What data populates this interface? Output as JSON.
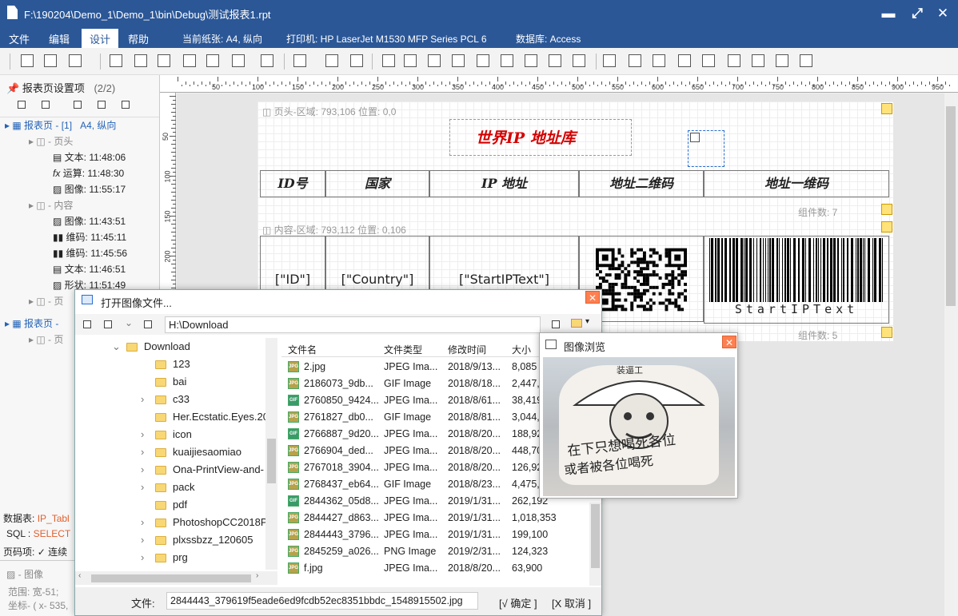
{
  "window": {
    "title": "F:\\190204\\Demo_1\\Demo_1\\bin\\Debug\\测试报表1.rpt"
  },
  "menu": {
    "items": [
      "文件",
      "编辑",
      "设计",
      "帮助"
    ],
    "paper": "当前纸张: A4, 纵向",
    "printer": "打印机: HP LaserJet M1530 MFP Series PCL 6",
    "database": "数据库: Access"
  },
  "left_panel": {
    "header": "报表页设置项",
    "count": "(2/2)",
    "tree": [
      {
        "label": "报表页 - [1]",
        "extra": "A4, 纵向"
      },
      {
        "label": "- 页头"
      },
      {
        "label": "文本: 11:48:06"
      },
      {
        "label": "运算: 11:48:30"
      },
      {
        "label": "图像: 11:55:17"
      },
      {
        "label": "- 内容"
      },
      {
        "label": "图像: 11:43:51"
      },
      {
        "label": "维码: 11:45:11"
      },
      {
        "label": "维码: 11:45:56"
      },
      {
        "label": "文本: 11:46:51"
      },
      {
        "label": "形状: 11:51:49"
      },
      {
        "label": "- 页"
      },
      {
        "label": "报表页 - "
      },
      {
        "label": "- 页"
      }
    ],
    "db_label": "数据表:",
    "db_value": "IP_Tabl",
    "sql_label": "SQL :",
    "sql_value": "SELECT",
    "page_label": "页码项:",
    "page_value": "✓ 连续",
    "status_title": "- 图像",
    "range": "范围: 宽-51;",
    "coords": "坐标- ( x- 535,"
  },
  "ruler": {
    "labels": [
      "50",
      "100",
      "150",
      "200",
      "250",
      "300",
      "350",
      "400",
      "450",
      "500",
      "550",
      "600",
      "650",
      "700",
      "750",
      "800",
      "850",
      "900",
      "950"
    ]
  },
  "vruler": {
    "labels": [
      "50",
      "100",
      "150",
      "200",
      "250"
    ]
  },
  "report": {
    "header_region": "页头-区域: 793,106    位置: 0,0",
    "title": "世界IP 地址库",
    "columns": [
      "ID号",
      "国家",
      "IP 地址",
      "地址二维码",
      "地址一维码"
    ],
    "header_count": "组件数: 7",
    "content_region": "内容-区域: 793,112    位置: 0,106",
    "cells": [
      "[\"ID\"]",
      "[\"Country\"]",
      "[\"StartIPText\"]"
    ],
    "barcode_text": "StartIPText",
    "content_count": "组件数: 5"
  },
  "dialog": {
    "title": "打开图像文件...",
    "path": "H:\\Download",
    "folders": [
      "Download",
      "123",
      "bai",
      "c33",
      "Her.Ecstatic.Eyes.20",
      "icon",
      "kuaijiesaomiao",
      "Ona-PrintView-and-",
      "pack",
      "pdf",
      "PhotoshopCC2018P",
      "plxssbzz_120605",
      "prg"
    ],
    "columns": [
      "文件名",
      "文件类型",
      "修改时间",
      "大小"
    ],
    "files": [
      {
        "name": "2.jpg",
        "type": "JPEG Ima...",
        "date": "2018/9/13...",
        "size": "8,085",
        "icon": "JPG"
      },
      {
        "name": "2186073_9db...",
        "type": "GIF Image",
        "date": "2018/8/18...",
        "size": "2,447,",
        "icon": "JPG"
      },
      {
        "name": "2760850_9424...",
        "type": "JPEG Ima...",
        "date": "2018/8/61...",
        "size": "38,419",
        "icon": "GIF"
      },
      {
        "name": "2761827_db0...",
        "type": "GIF Image",
        "date": "2018/8/81...",
        "size": "3,044,",
        "icon": "JPG"
      },
      {
        "name": "2766887_9d20...",
        "type": "JPEG Ima...",
        "date": "2018/8/20...",
        "size": "188,92",
        "icon": "GIF"
      },
      {
        "name": "2766904_ded...",
        "type": "JPEG Ima...",
        "date": "2018/8/20...",
        "size": "448,70",
        "icon": "JPG"
      },
      {
        "name": "2767018_3904...",
        "type": "JPEG Ima...",
        "date": "2018/8/20...",
        "size": "126,92",
        "icon": "JPG"
      },
      {
        "name": "2768437_eb64...",
        "type": "GIF Image",
        "date": "2018/8/23...",
        "size": "4,475,",
        "icon": "JPG"
      },
      {
        "name": "2844362_05d8...",
        "type": "JPEG Ima...",
        "date": "2019/1/31...",
        "size": "262,192",
        "icon": "GIF"
      },
      {
        "name": "2844427_d863...",
        "type": "JPEG Ima...",
        "date": "2019/1/31...",
        "size": "1,018,353",
        "icon": "JPG"
      },
      {
        "name": "2844443_3796...",
        "type": "JPEG Ima...",
        "date": "2019/1/31...",
        "size": "199,100",
        "icon": "JPG"
      },
      {
        "name": "2845259_a026...",
        "type": "PNG Image",
        "date": "2019/2/31...",
        "size": "124,323",
        "icon": "JPG"
      },
      {
        "name": "f.jpg",
        "type": "JPEG Ima...",
        "date": "2018/8/20...",
        "size": "63,900",
        "icon": "JPG"
      }
    ],
    "file_label": "文件:",
    "file_value": "2844443_379619f5eade6ed9fcdb52ec8351bbdc_1548915502.jpg",
    "ok": "[√ 确定 ]",
    "cancel": "[X 取消 ]"
  },
  "preview": {
    "title": "图像浏览",
    "hat": "装逼工",
    "line1": "在下只想喝死各位",
    "line2": "或者被各位喝死"
  }
}
